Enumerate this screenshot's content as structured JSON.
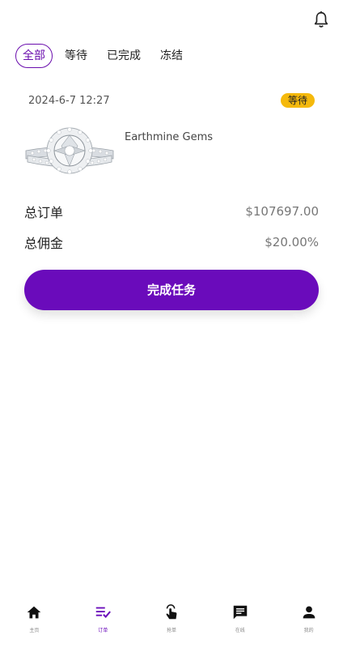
{
  "header": {
    "bell_icon": "bell-icon"
  },
  "tabs": [
    {
      "label": "全部",
      "active": true
    },
    {
      "label": "等待",
      "active": false
    },
    {
      "label": "已完成",
      "active": false
    },
    {
      "label": "冻结",
      "active": false
    }
  ],
  "order": {
    "date": "2024-6-7 12:27",
    "status": "等待",
    "product_name": "Earthmine Gems",
    "product_image": "diamond-ring-image",
    "total_order_label": "总订单",
    "total_order_value": "$107697.00",
    "commission_label": "总佣金",
    "commission_value": "$20.00%",
    "complete_button": "完成任务"
  },
  "bottom_nav": [
    {
      "label": "主页",
      "icon": "home-icon",
      "active": false
    },
    {
      "label": "订单",
      "icon": "orders-icon",
      "active": true
    },
    {
      "label": "抢单",
      "icon": "tap-hand-icon",
      "active": false
    },
    {
      "label": "在线",
      "icon": "chat-icon",
      "active": false
    },
    {
      "label": "我的",
      "icon": "person-icon",
      "active": false
    }
  ],
  "colors": {
    "accent": "#6a0bbb",
    "badge": "#f5b90c"
  }
}
